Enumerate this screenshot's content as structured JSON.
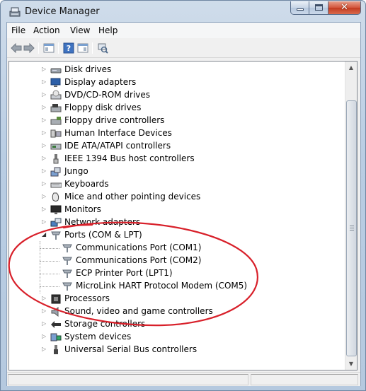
{
  "window": {
    "title": "Device Manager"
  },
  "menu": {
    "items": [
      "File",
      "Action",
      "View",
      "Help"
    ]
  },
  "toolbar": {
    "buttons": [
      "back-icon",
      "forward-icon",
      "show-hide-console-tree-icon",
      "help-icon",
      "properties-icon",
      "scan-hardware-icon"
    ]
  },
  "tree": {
    "nodes": [
      {
        "label": "Disk drives",
        "icon": "disk-drive-icon",
        "expanded": false
      },
      {
        "label": "Display adapters",
        "icon": "display-adapter-icon",
        "expanded": false
      },
      {
        "label": "DVD/CD-ROM drives",
        "icon": "dvd-drive-icon",
        "expanded": false
      },
      {
        "label": "Floppy disk drives",
        "icon": "floppy-disk-icon",
        "expanded": false
      },
      {
        "label": "Floppy drive controllers",
        "icon": "floppy-controller-icon",
        "expanded": false
      },
      {
        "label": "Human Interface Devices",
        "icon": "hid-icon",
        "expanded": false
      },
      {
        "label": "IDE ATA/ATAPI controllers",
        "icon": "ide-controller-icon",
        "expanded": false
      },
      {
        "label": "IEEE 1394 Bus host controllers",
        "icon": "ieee1394-icon",
        "expanded": false
      },
      {
        "label": "Jungo",
        "icon": "jungo-icon",
        "expanded": false
      },
      {
        "label": "Keyboards",
        "icon": "keyboard-icon",
        "expanded": false
      },
      {
        "label": "Mice and other pointing devices",
        "icon": "mouse-icon",
        "expanded": false
      },
      {
        "label": "Monitors",
        "icon": "monitor-icon",
        "expanded": false
      },
      {
        "label": "Network adapters",
        "icon": "network-adapter-icon",
        "expanded": false
      },
      {
        "label": "Ports (COM & LPT)",
        "icon": "port-icon",
        "expanded": true
      },
      {
        "label": "Communications Port (COM1)",
        "icon": "port-icon",
        "child": true
      },
      {
        "label": "Communications Port (COM2)",
        "icon": "port-icon",
        "child": true
      },
      {
        "label": "ECP Printer Port (LPT1)",
        "icon": "port-icon",
        "child": true
      },
      {
        "label": "MicroLink HART Protocol Modem (COM5)",
        "icon": "port-icon",
        "child": true
      },
      {
        "label": "Processors",
        "icon": "processor-icon",
        "expanded": false
      },
      {
        "label": "Sound, video and game controllers",
        "icon": "sound-icon",
        "expanded": false
      },
      {
        "label": "Storage controllers",
        "icon": "storage-controller-icon",
        "expanded": false
      },
      {
        "label": "System devices",
        "icon": "system-device-icon",
        "expanded": false
      },
      {
        "label": "Universal Serial Bus controllers",
        "icon": "usb-icon",
        "expanded": false
      }
    ]
  },
  "annotation": {
    "color": "#d8202a"
  }
}
